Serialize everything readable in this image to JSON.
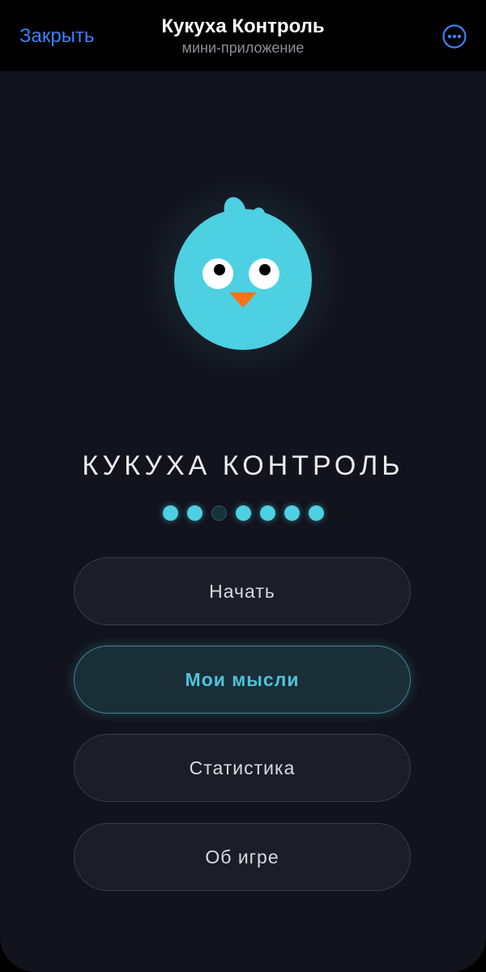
{
  "header": {
    "close_label": "Закрыть",
    "title": "Кукуха Контроль",
    "subtitle": "мини-приложение",
    "more_icon": "more-icon"
  },
  "main": {
    "mascot_icon": "bird-icon",
    "game_title": "КУКУХА КОНТРОЛЬ",
    "indicator": {
      "total": 7,
      "states": [
        true,
        true,
        false,
        true,
        true,
        true,
        true
      ]
    },
    "menu": [
      {
        "label": "Начать",
        "active": false
      },
      {
        "label": "Мои мысли",
        "active": true
      },
      {
        "label": "Статистика",
        "active": false
      },
      {
        "label": "Об игре",
        "active": false
      }
    ]
  },
  "colors": {
    "accent": "#4dd0e1",
    "link": "#3b82f6",
    "background": "#12131d",
    "beak": "#f97316"
  }
}
